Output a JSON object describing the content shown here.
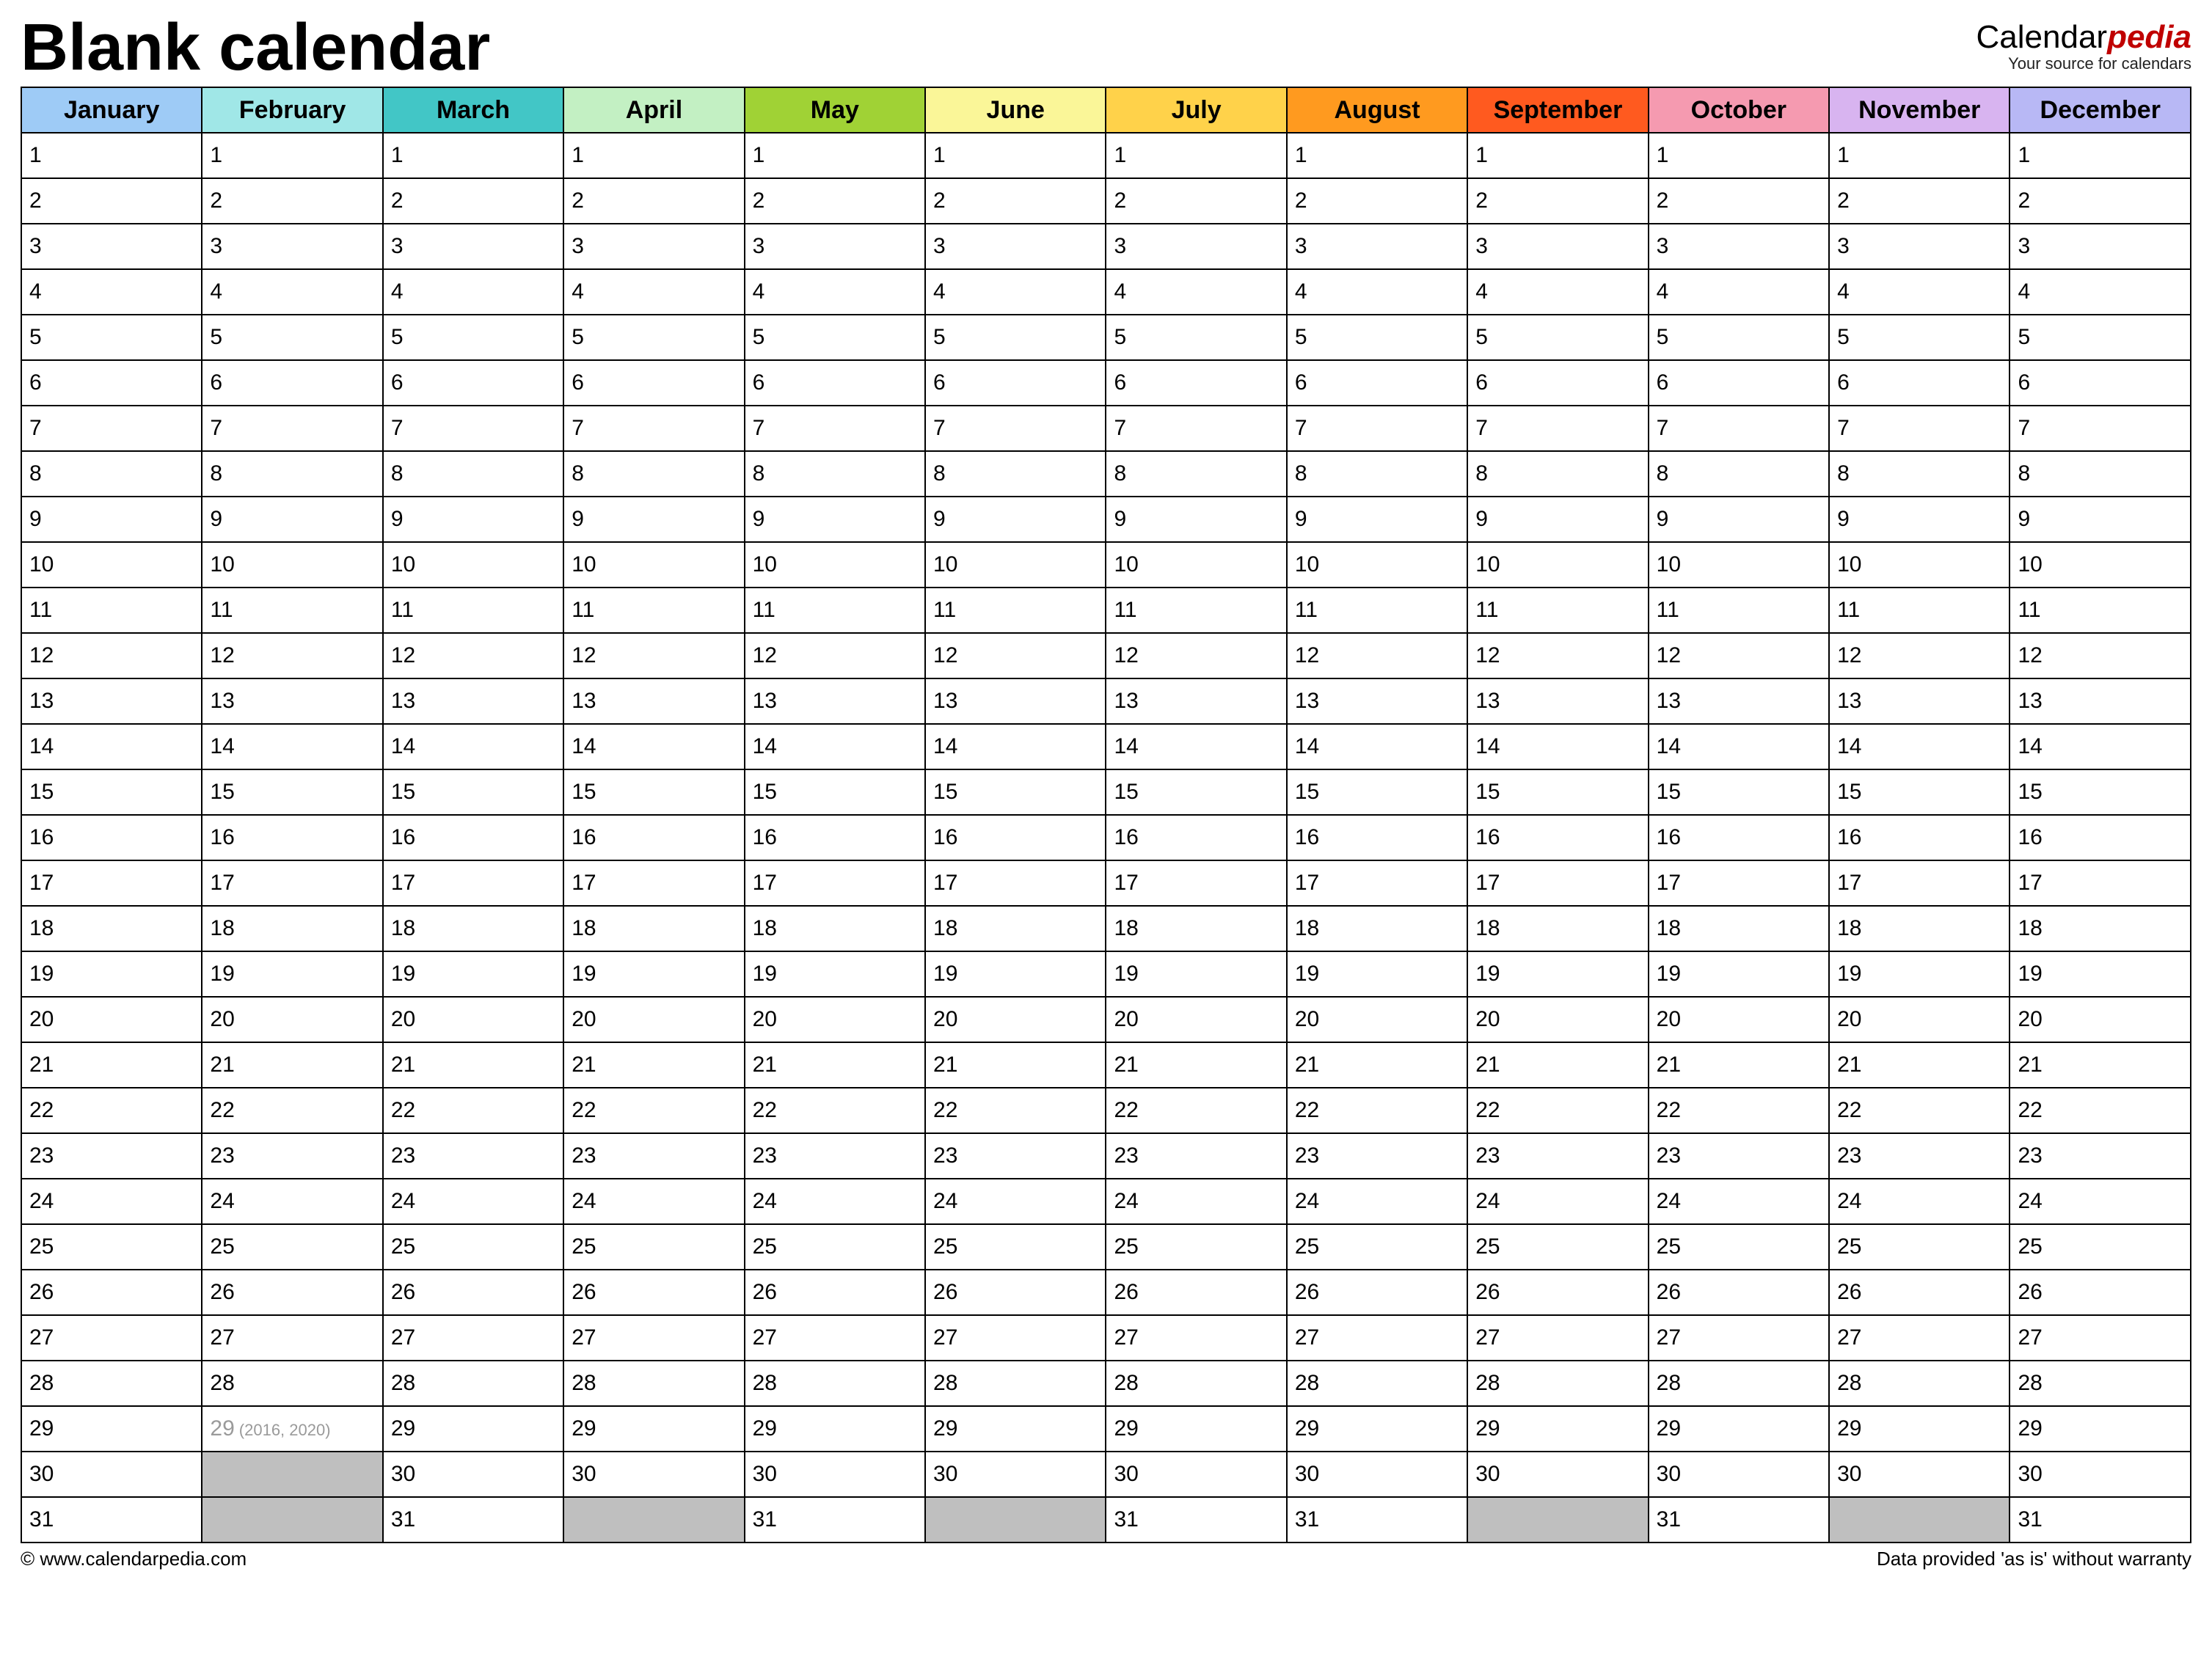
{
  "header": {
    "title": "Blank calendar",
    "brand_prefix": "Calendar",
    "brand_accent": "pedia",
    "brand_tag": "Your source for calendars"
  },
  "months": [
    {
      "name": "January",
      "color": "#9ecbf6",
      "days": 31
    },
    {
      "name": "February",
      "color": "#a0e7e7",
      "days": 28,
      "leap_day": 29,
      "leap_note": "(2016, 2020)"
    },
    {
      "name": "March",
      "color": "#42c6c6",
      "days": 31
    },
    {
      "name": "April",
      "color": "#c3f0c3",
      "days": 30
    },
    {
      "name": "May",
      "color": "#a0d235",
      "days": 31
    },
    {
      "name": "June",
      "color": "#faf698",
      "days": 30
    },
    {
      "name": "July",
      "color": "#ffd24a",
      "days": 31
    },
    {
      "name": "August",
      "color": "#ff9a1f",
      "days": 31
    },
    {
      "name": "September",
      "color": "#ff5a1f",
      "days": 30
    },
    {
      "name": "October",
      "color": "#f59ab0",
      "days": 31
    },
    {
      "name": "November",
      "color": "#d8b4f0",
      "days": 30
    },
    {
      "name": "December",
      "color": "#b8b8f5",
      "days": 31
    }
  ],
  "max_rows": 31,
  "footer": {
    "left": "© www.calendarpedia.com",
    "right": "Data provided 'as is' without warranty"
  }
}
